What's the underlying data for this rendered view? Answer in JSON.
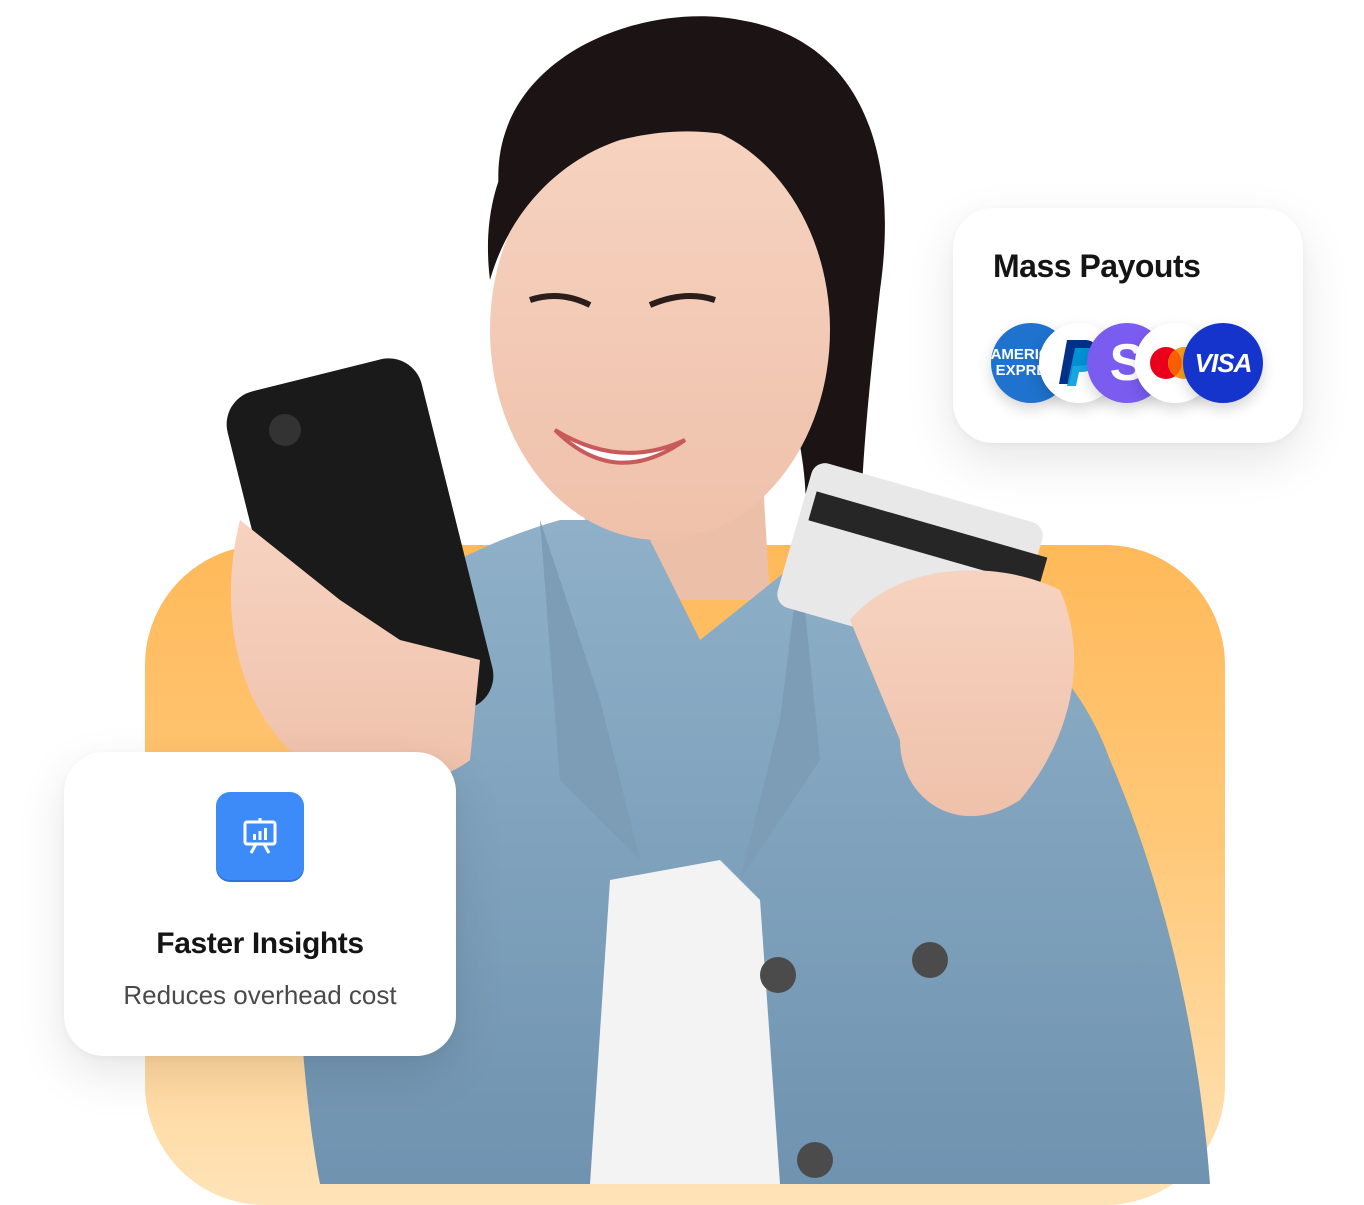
{
  "payouts_card": {
    "title": "Mass Payouts",
    "logos": {
      "amex": "AMERICAN EXPRESS",
      "skrill": "S",
      "visa": "VISA"
    }
  },
  "insights_card": {
    "title": "Faster Insights",
    "subtitle": "Reduces overhead cost",
    "icon": "presentation-chart-icon"
  },
  "colors": {
    "orange_panel": "#ffb95a",
    "icon_blue": "#3d8bf8",
    "amex_blue": "#1f72cd",
    "skrill_purple": "#7b5cf0",
    "visa_blue": "#1434cb"
  }
}
